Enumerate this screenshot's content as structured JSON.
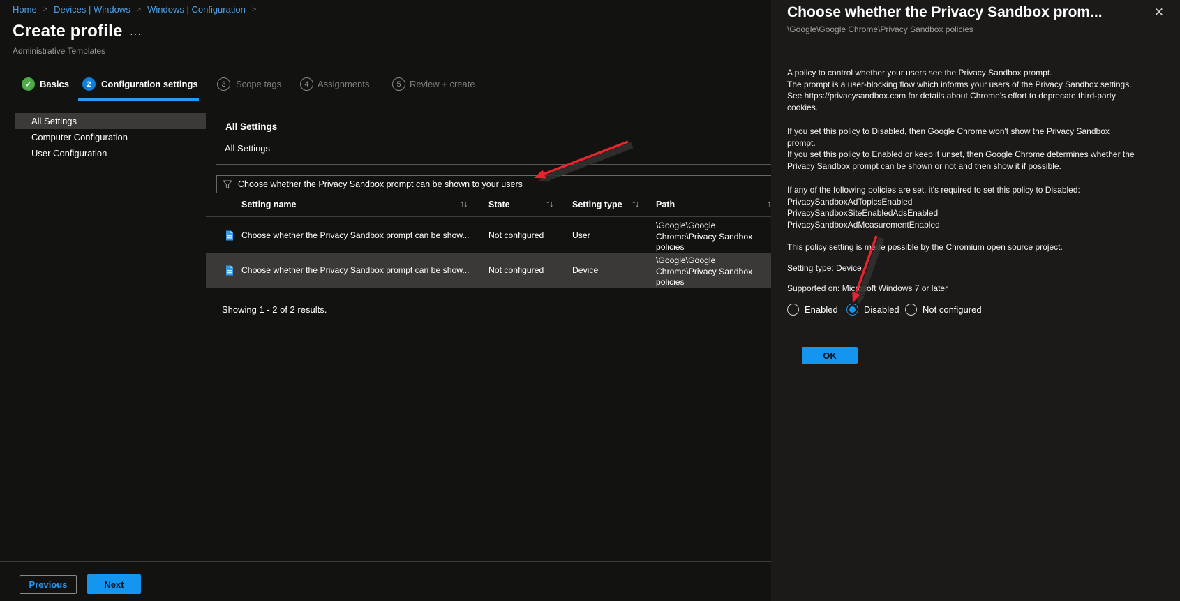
{
  "breadcrumb": {
    "items": [
      "Home",
      "Devices | Windows",
      "Windows | Configuration"
    ],
    "separator": ">"
  },
  "header": {
    "title": "Create profile",
    "menu_dots": "···",
    "subtitle": "Administrative Templates"
  },
  "steps": [
    {
      "num": "✓",
      "label": "Basics",
      "state": "done"
    },
    {
      "num": "2",
      "label": "Configuration settings",
      "state": "current"
    },
    {
      "num": "3",
      "label": "Scope tags",
      "state": "todo"
    },
    {
      "num": "4",
      "label": "Assignments",
      "state": "todo"
    },
    {
      "num": "5",
      "label": "Review + create",
      "state": "todo"
    }
  ],
  "nav": {
    "items": [
      "All Settings",
      "Computer Configuration",
      "User Configuration"
    ],
    "selected": "All Settings"
  },
  "main": {
    "heading": "All Settings",
    "subheading": "All Settings",
    "filter_value": "Choose whether the Privacy Sandbox prompt can be shown to your users",
    "columns": [
      "Setting name",
      "State",
      "Setting type",
      "Path"
    ],
    "sort_glyph": "↑↓",
    "sort_glyph_up": "↑",
    "rows": [
      {
        "name": "Choose whether the Privacy Sandbox prompt can be show...",
        "state": "Not configured",
        "type": "User",
        "path": "\\Google\\Google Chrome\\Privacy Sandbox policies",
        "selected": false
      },
      {
        "name": "Choose whether the Privacy Sandbox prompt can be show...",
        "state": "Not configured",
        "type": "Device",
        "path": "\\Google\\Google Chrome\\Privacy Sandbox policies",
        "selected": true
      }
    ],
    "summary": "Showing 1 - 2 of 2 results."
  },
  "footer": {
    "previous": "Previous",
    "next": "Next"
  },
  "panel": {
    "title": "Choose whether the Privacy Sandbox prom...",
    "close_glyph": "✕",
    "path": "\\Google\\Google Chrome\\Privacy Sandbox policies",
    "paragraphs": [
      "A policy to control whether your users see the Privacy Sandbox prompt.\nThe prompt is a user-blocking flow which informs your users of the Privacy Sandbox settings.\nSee https://privacysandbox.com for details about Chrome's effort to deprecate third-party\ncookies.",
      "If you set this policy to Disabled, then Google Chrome won't show the Privacy Sandbox\nprompt.\nIf you set this policy to Enabled or keep it unset, then Google Chrome determines whether the\nPrivacy Sandbox prompt can be shown or not and then show it if possible.",
      "If any of the following policies are set, it's required to set this policy to Disabled:\nPrivacySandboxAdTopicsEnabled\nPrivacySandboxSiteEnabledAdsEnabled\nPrivacySandboxAdMeasurementEnabled",
      "This policy setting is made possible by the Chromium open source project.",
      "Setting type: Device",
      "Supported on: Microsoft Windows 7 or later"
    ],
    "radios": [
      {
        "label": "Enabled",
        "selected": false
      },
      {
        "label": "Disabled",
        "selected": true
      },
      {
        "label": "Not configured",
        "selected": false
      }
    ],
    "ok_label": "OK"
  },
  "colors": {
    "background": "#121211",
    "panel_background": "#1b1a19",
    "highlight": "#3b3a39",
    "accent_blue": "#1496f0",
    "link_blue": "#4da1e8",
    "step_done_green": "#4caa47",
    "annotation_red": "#e8252e",
    "secondary_text": "#a19f9d"
  }
}
